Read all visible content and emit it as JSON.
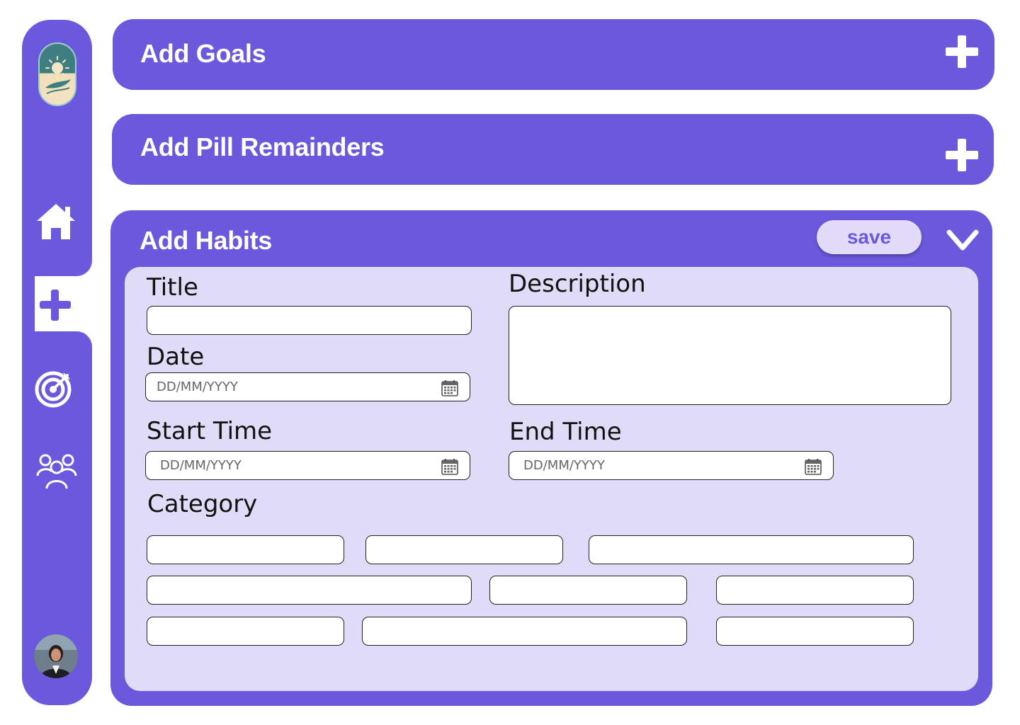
{
  "sidebar": {
    "logo_icon": "sun-leaf-logo-icon",
    "items": [
      {
        "name": "home",
        "icon": "home-icon",
        "active": false
      },
      {
        "name": "add",
        "icon": "plus-icon",
        "active": true
      },
      {
        "name": "goals",
        "icon": "target-icon",
        "active": false
      },
      {
        "name": "community",
        "icon": "users-icon",
        "active": false
      }
    ],
    "avatar_icon": "user-avatar"
  },
  "panels": {
    "goals": {
      "title": "Add Goals",
      "action_icon": "plus-icon"
    },
    "pills": {
      "title": "Add Pill Remainders",
      "action_icon": "plus-icon"
    },
    "habits": {
      "title": "Add Habits",
      "save_label": "save",
      "collapse_icon": "chevron-down-icon"
    }
  },
  "form": {
    "title_label": "Title",
    "title_value": "",
    "description_label": "Description",
    "description_value": "",
    "date_label": "Date",
    "date_placeholder": "DD/MM/YYYY",
    "start_time_label": "Start Time",
    "start_time_placeholder": "DD/MM/YYYY",
    "end_time_label": "End Time",
    "end_time_placeholder": "DD/MM/YYYY",
    "category_label": "Category",
    "category_options": [
      "",
      "",
      "",
      "",
      "",
      "",
      "",
      "",
      ""
    ]
  },
  "colors": {
    "primary": "#6a59dc",
    "card_background": "#e0dbf7",
    "save_button_bg": "#e2dcf8",
    "white": "#ffffff"
  }
}
